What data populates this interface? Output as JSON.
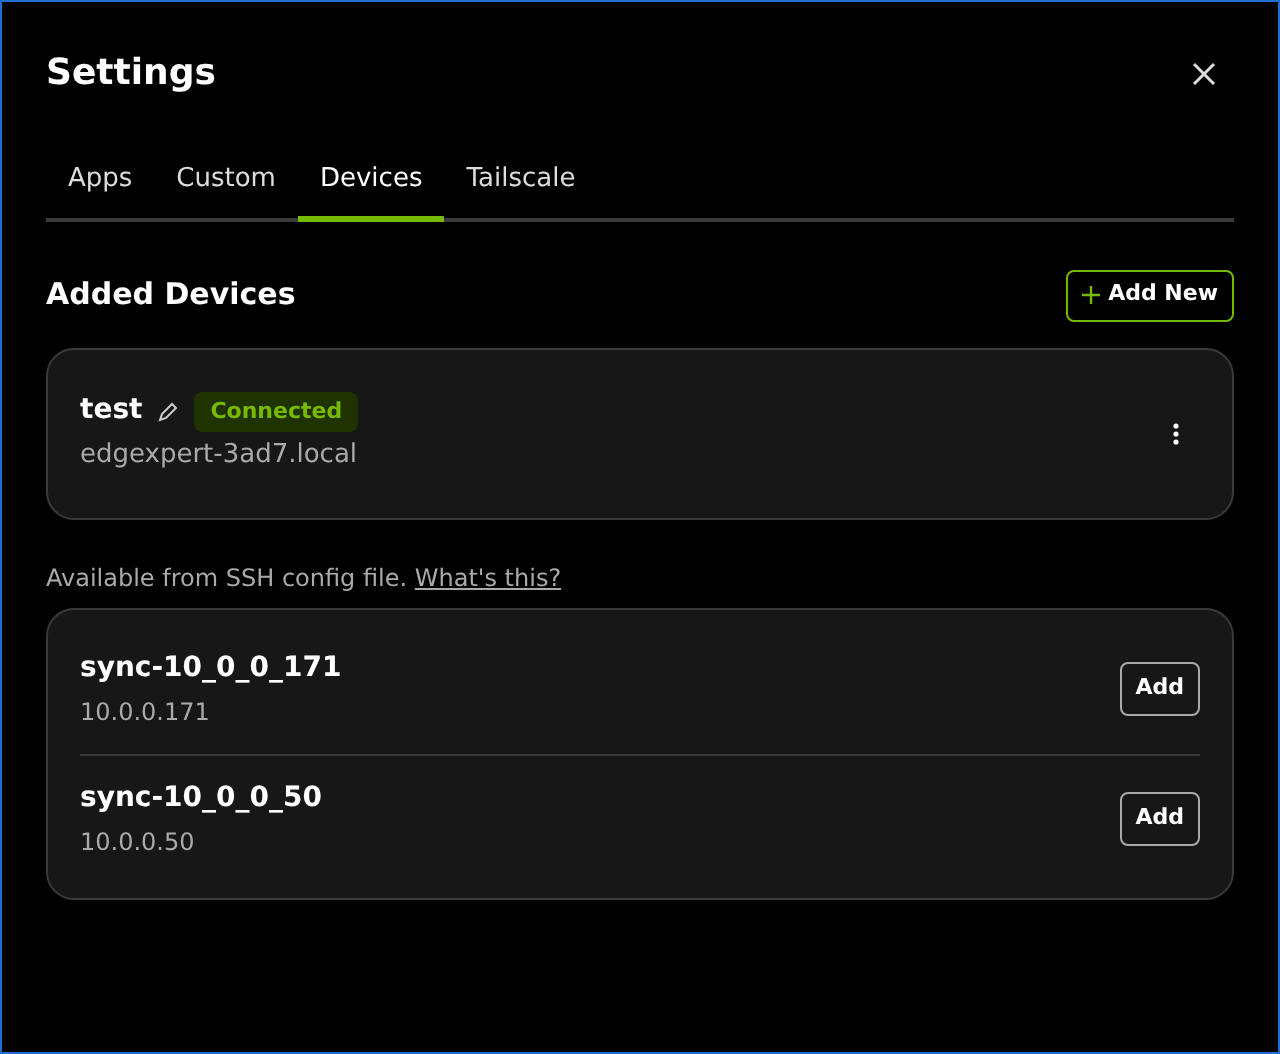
{
  "dialog": {
    "title": "Settings"
  },
  "tabs": [
    {
      "label": "Apps",
      "selected": false
    },
    {
      "label": "Custom",
      "selected": false
    },
    {
      "label": "Devices",
      "selected": true
    },
    {
      "label": "Tailscale",
      "selected": false
    }
  ],
  "added_devices": {
    "heading": "Added Devices",
    "add_button": "Add New",
    "devices": [
      {
        "name": "test",
        "host": "edgexpert-3ad7.local",
        "status": {
          "label": "Connected",
          "kind": "connected"
        }
      }
    ]
  },
  "ssh_config": {
    "hint": "Available from SSH config file.",
    "link": "What's this?",
    "hosts": [
      {
        "name": "sync-10_0_0_171",
        "address": "10.0.0.171",
        "button": "Add"
      },
      {
        "name": "sync-10_0_0_50",
        "address": "10.0.0.50",
        "button": "Add"
      }
    ]
  }
}
